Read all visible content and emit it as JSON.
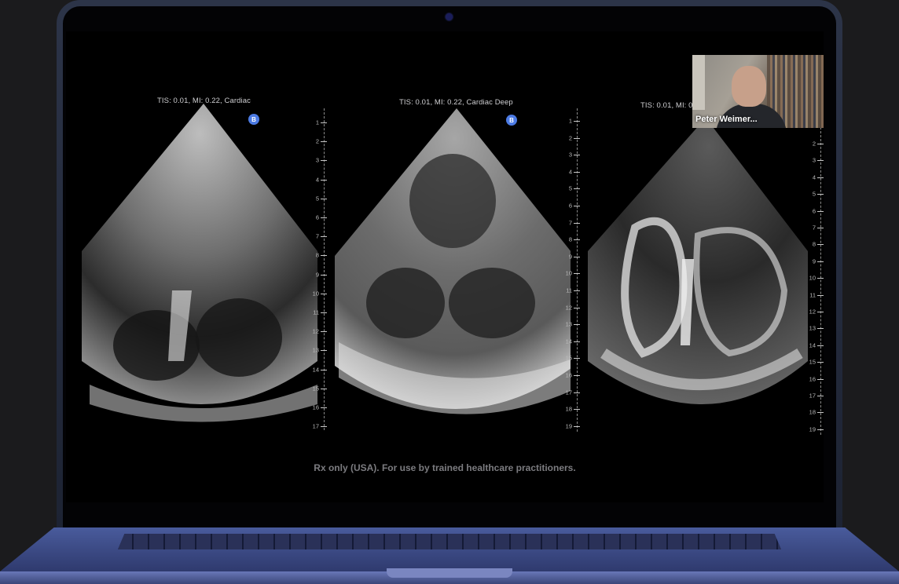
{
  "panels": [
    {
      "label": "TIS: 0.01, MI: 0.22, Cardiac",
      "badge": "B",
      "ticks": [
        "1",
        "2",
        "3",
        "4",
        "5",
        "6",
        "7",
        "8",
        "9",
        "10",
        "11",
        "12",
        "13",
        "14",
        "15",
        "16",
        "17"
      ]
    },
    {
      "label": "TIS: 0.01, MI: 0.22, Cardiac Deep",
      "badge": "B",
      "ticks": [
        "1",
        "2",
        "3",
        "4",
        "5",
        "6",
        "7",
        "8",
        "9",
        "10",
        "11",
        "12",
        "13",
        "14",
        "15",
        "16",
        "17",
        "18",
        "19"
      ]
    },
    {
      "label": "TIS: 0.01, MI: 0",
      "ticks": [
        "2",
        "3",
        "4",
        "5",
        "6",
        "7",
        "8",
        "9",
        "10",
        "11",
        "12",
        "13",
        "14",
        "15",
        "16",
        "17",
        "18",
        "19"
      ]
    }
  ],
  "video": {
    "participant_name": "Peter Weimer..."
  },
  "disclaimer": "Rx only (USA). For use by trained healthcare practitioners.",
  "colors": {
    "badge": "#4c7be4",
    "laptop_body": "#3f4f8f",
    "screen": "#000000"
  }
}
